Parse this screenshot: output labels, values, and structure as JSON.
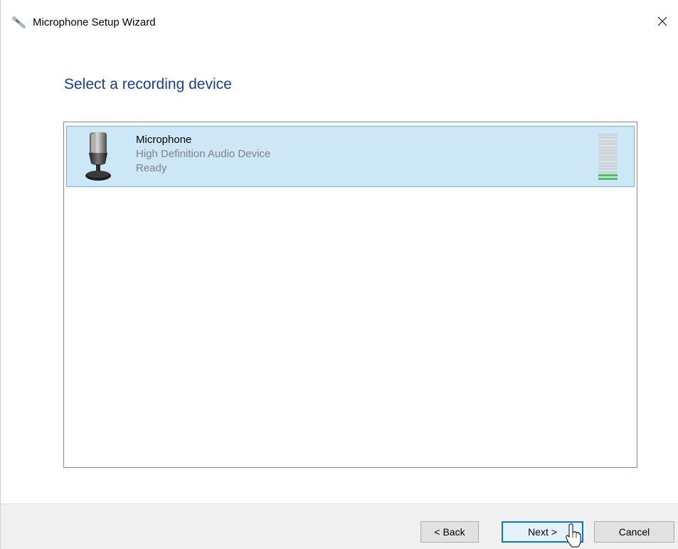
{
  "window": {
    "title": "Microphone Setup Wizard",
    "title_icon": "microphone-wand-icon",
    "close_icon": "close-icon"
  },
  "page": {
    "heading": "Select a recording device",
    "heading_color": "#1a3e94"
  },
  "device_list": {
    "items": [
      {
        "name": "Microphone",
        "description": "High Definition Audio Device",
        "status": "Ready",
        "icon": "microphone-icon",
        "selected": true,
        "level_segments_total": 15,
        "level_segments_active": 2
      }
    ],
    "selection_color": "#cce8f7",
    "selection_border_color": "#6fb1e2"
  },
  "footer": {
    "back_label": "< Back",
    "next_label": "Next >",
    "cancel_label": "Cancel"
  },
  "colors": {
    "accent": "#0078d7",
    "level_active": "#4cc35a",
    "level_inactive": "#d3d3d3"
  }
}
